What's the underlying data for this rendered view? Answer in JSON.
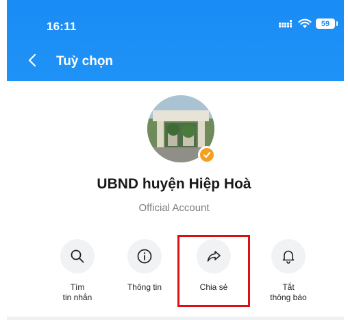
{
  "status_bar": {
    "time": "16:11",
    "battery": "59"
  },
  "header": {
    "title": "Tuỳ chọn"
  },
  "profile": {
    "name": "UBND huyện Hiệp Hoà",
    "account_type": "Official Account"
  },
  "actions": [
    {
      "line1": "Tìm",
      "line2": "tin nhắn",
      "icon": "search-icon"
    },
    {
      "line1": "Thông tin",
      "line2": "",
      "icon": "info-icon"
    },
    {
      "line1": "Chia sẻ",
      "line2": "",
      "icon": "share-icon"
    },
    {
      "line1": "Tắt",
      "line2": "thông báo",
      "icon": "bell-icon"
    }
  ],
  "colors": {
    "header": "#1a8cf5",
    "verified_badge": "#f4a01e",
    "highlight": "#e00d13"
  }
}
